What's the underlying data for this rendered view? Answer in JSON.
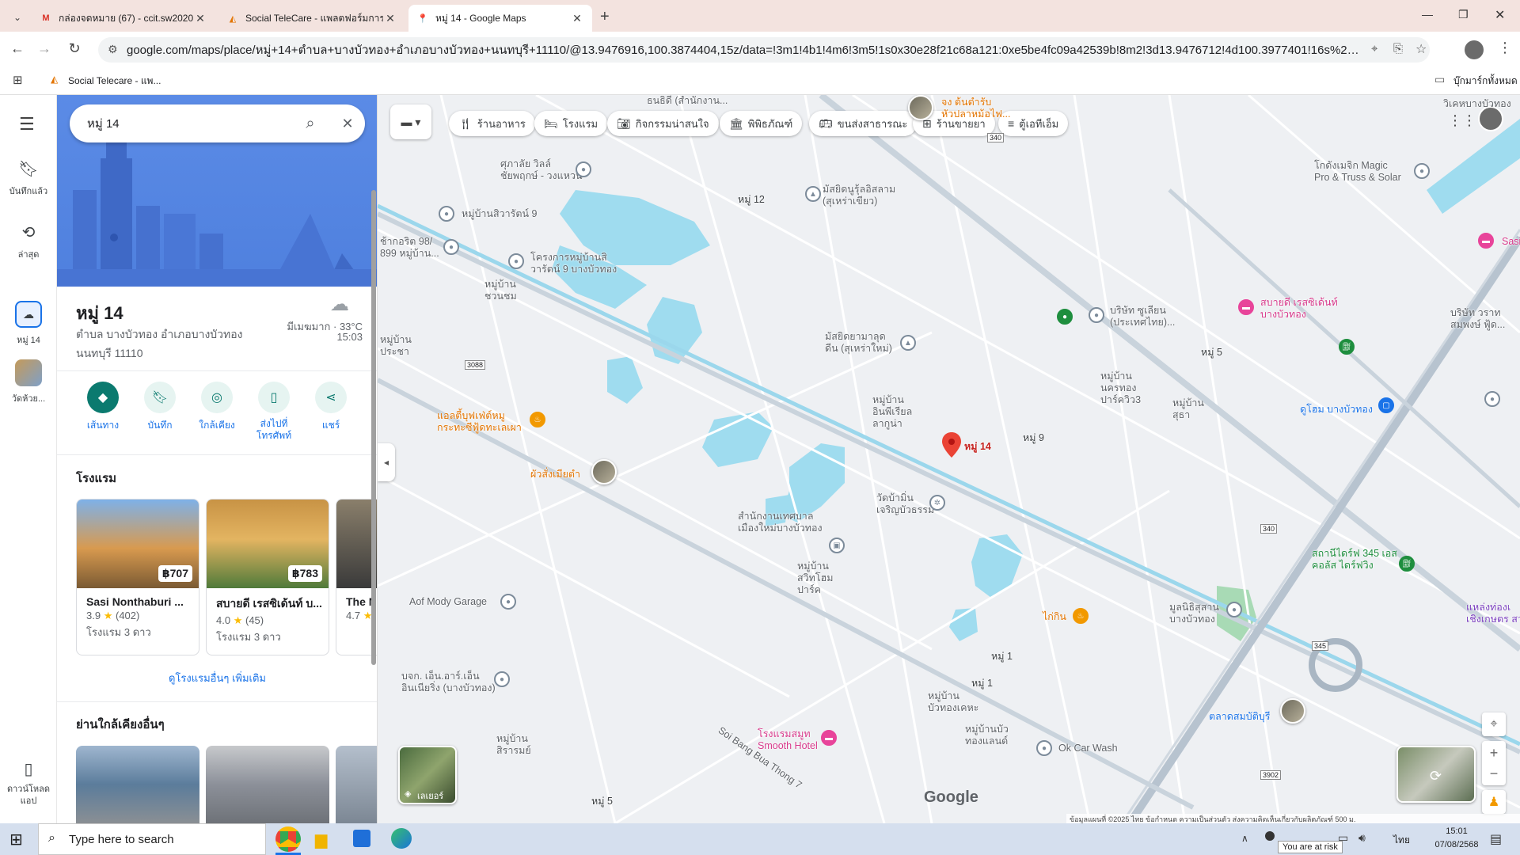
{
  "browser": {
    "tabs": [
      {
        "title": "กล่องจดหมาย (67) - ccit.sw2020@",
        "icon": "gmail-icon"
      },
      {
        "title": "Social TeleCare - แพลตฟอร์มการ",
        "icon": "telecare-icon"
      },
      {
        "title": "หมู่ 14 - Google Maps",
        "icon": "maps-pin-icon"
      }
    ],
    "url": "google.com/maps/place/หมู่+14+ตำบล+บางบัวทอง+อำเภอบางบัวทอง+นนทบุรี+11110/@13.9476916,100.3874404,15z/data=!3m1!4b1!4m6!3m5!1s0x30e28f21c68a121:0xe5be4fc09a42539b!8m2!3d13.9476712!4d100.3977401!16s%2Fg%2F1ptynp5v_?authuse...",
    "bookmark": "Social Telecare - แพ...",
    "all_bookmarks": "บุ๊กมาร์กทั้งหมด"
  },
  "rail": {
    "saved": "บันทึกแล้ว",
    "recent": "ล่าสุด",
    "recent_place": "หมู่ 14",
    "wat": "วัดห้วย...",
    "download": "ดาวน์โหลดแอป"
  },
  "search": {
    "query": "หมู่ 14"
  },
  "place": {
    "name": "หมู่ 14",
    "address": "ตำบล บางบัวทอง อำเภอบางบัวทอง นนทบุรี 11110",
    "weather": "มีเมฆมาก · 33°C",
    "time": "15:03"
  },
  "actions": [
    {
      "label": "เส้นทาง"
    },
    {
      "label": "บันทึก"
    },
    {
      "label": "ใกล้เคียง"
    },
    {
      "label": "ส่งไปที่โทรศัพท์"
    },
    {
      "label": "แชร์"
    }
  ],
  "hotels": {
    "heading": "โรงแรม",
    "items": [
      {
        "name": "Sasi Nonthaburi ...",
        "price": "฿707",
        "rating": "3.9",
        "reviews": "(402)",
        "type": "โรงแรม 3 ดาว"
      },
      {
        "name": "สบายดี เรสซิเด้นท์ บ...",
        "price": "฿783",
        "rating": "4.0",
        "reviews": "(45)",
        "type": "โรงแรม 3 ดาว"
      },
      {
        "name": "The N",
        "rating": "4.7"
      }
    ],
    "more": "ดูโรงแรมอื่นๆ เพิ่มเติม"
  },
  "nearby": {
    "heading": "ย่านใกล้เคียงอื่นๆ"
  },
  "chips": [
    {
      "label": "ร้านอาหาร",
      "icon": "fork-knife-icon"
    },
    {
      "label": "โรงแรม",
      "icon": "bed-icon"
    },
    {
      "label": "กิจกรรมน่าสนใจ",
      "icon": "camera-icon"
    },
    {
      "label": "พิพิธภัณฑ์",
      "icon": "museum-icon"
    },
    {
      "label": "ขนส่งสาธารณะ",
      "icon": "bus-icon"
    },
    {
      "label": "ร้านขายยา",
      "icon": "pharmacy-icon"
    },
    {
      "label": "ตู้เอทีเอ็ม",
      "icon": "atm-icon"
    }
  ],
  "map_labels": {
    "moo12": "หมู่ 12",
    "moo5": "หมู่ 5",
    "moo9": "หมู่ 9",
    "moo1a": "หมู่ 1",
    "moo1b": "หมู่ 1",
    "moo5b": "หมู่ 5",
    "pin": "หมู่ 14",
    "sala": "ศุภาลัย วิลล์\nชัยพฤกษ์ - วงแหวน",
    "sawan": "หมู่บ้านสิวารัตน์ 9",
    "chako": "ช้ากอริต 98/\n899 หมู่บ้าน...",
    "khrongkan": "โครงการหมู่บ้านสิ\nวารัตน์ 9 บางบัวทอง",
    "chuan": "หมู่บ้าน\nชวนชม",
    "prachaa": "หมู่บ้าน\nประชา",
    "masjid1": "มัสยิดนูรุ้ลอิสลาม\n(สุเหร่าเขียว)",
    "masjid2": "มัสยิดยามาลุด\nดีน (สุเหร่าใหม่)",
    "inpi": "หมู่บ้าน\nอินพีเรียล\nลากูน่า",
    "watbua": "วัดบ้ามิ่น\nเจริญบัวธรรม",
    "office": "สำนักงานเทศบาล\nเมืองใหม่บางบัวทอง",
    "sawitch": "หมู่บ้าน\nสวิทโฮม\nปาร์ค",
    "aof": "Aof Mody Garage",
    "nor": "บจก. เอ็น.อาร์.เอ็น\nอินเนียริ่ง (บางบัวทอง)",
    "sirarom": "หมู่บ้าน\nสิรารมย์",
    "bangkha": "หมู่บ้าน\nบัวทองเคหะ",
    "bualand": "หมู่บ้านบัว\nทองแลนด์",
    "okcar": "Ok Car Wash",
    "smooth": "โรงแรมสมูท\nSmooth Hotel",
    "kaikin": "ไก่กิน",
    "aofbuffet": "แอลตี้บุฟเฟ่ต์หมู\nกระทะซีฟู้ดทะเลเผา",
    "pholsang": "ผัวสั่งเมียตำ",
    "nakhong": "หมู่บ้าน\nนครทอง\nปาร์ควิว3",
    "sutha": "หมู่บ้าน\nสุธา",
    "jusla": "บริษัท ซูเลียน\n(ประเทศไทย)...",
    "sabaidee": "สบายดี เรสซิเด้นท์\nบางบัวทอง",
    "tohome": "ดูโฮม บางบัวทอง",
    "magic": "โกดังเมจิก Magic\nPro & Truss & Solar",
    "jong": "จง ต้นตำรับ\nหัวปลาหม้อไฟ...",
    "thanadee": "ธนธิดี (สำนักงาน...",
    "market": "ตลาดสมบัติบุรี",
    "foundation": "มูลนิธิสุสาน\nบางบัวทอง",
    "esso": "สถานีไดร์ฟ 345 เอส\nคอลัส ไดร์ฟวิง",
    "sas": "Sasi",
    "wichit": "วิเคหบางบัวทอง",
    "bori": "บริษัท วราท\nสมพงษ์ ฟู้ด...",
    "road340": "340",
    "road3088": "3088",
    "road345": "345",
    "road3902": "3902",
    "layer": "เลเยอร์",
    "google": "Google",
    "footer": "ข้อมูลแผนที่ ©2025    ไทย    ข้อกำหนด    ความเป็นส่วนตัว    ส่งความคิดเห็นเกี่ยวกับผลิตภัณฑ์    500 ม.",
    "soi_bangbua": "Soi Bang Bua Thong 7",
    "kaeng": "แหล่งท่องเ\nเชิงเกษตร สวน ร"
  },
  "taskbar": {
    "search_placeholder": "Type here to search",
    "time": "15:01",
    "date": "07/08/2568",
    "lang": "ไทย",
    "tooltip": "You are at risk"
  }
}
